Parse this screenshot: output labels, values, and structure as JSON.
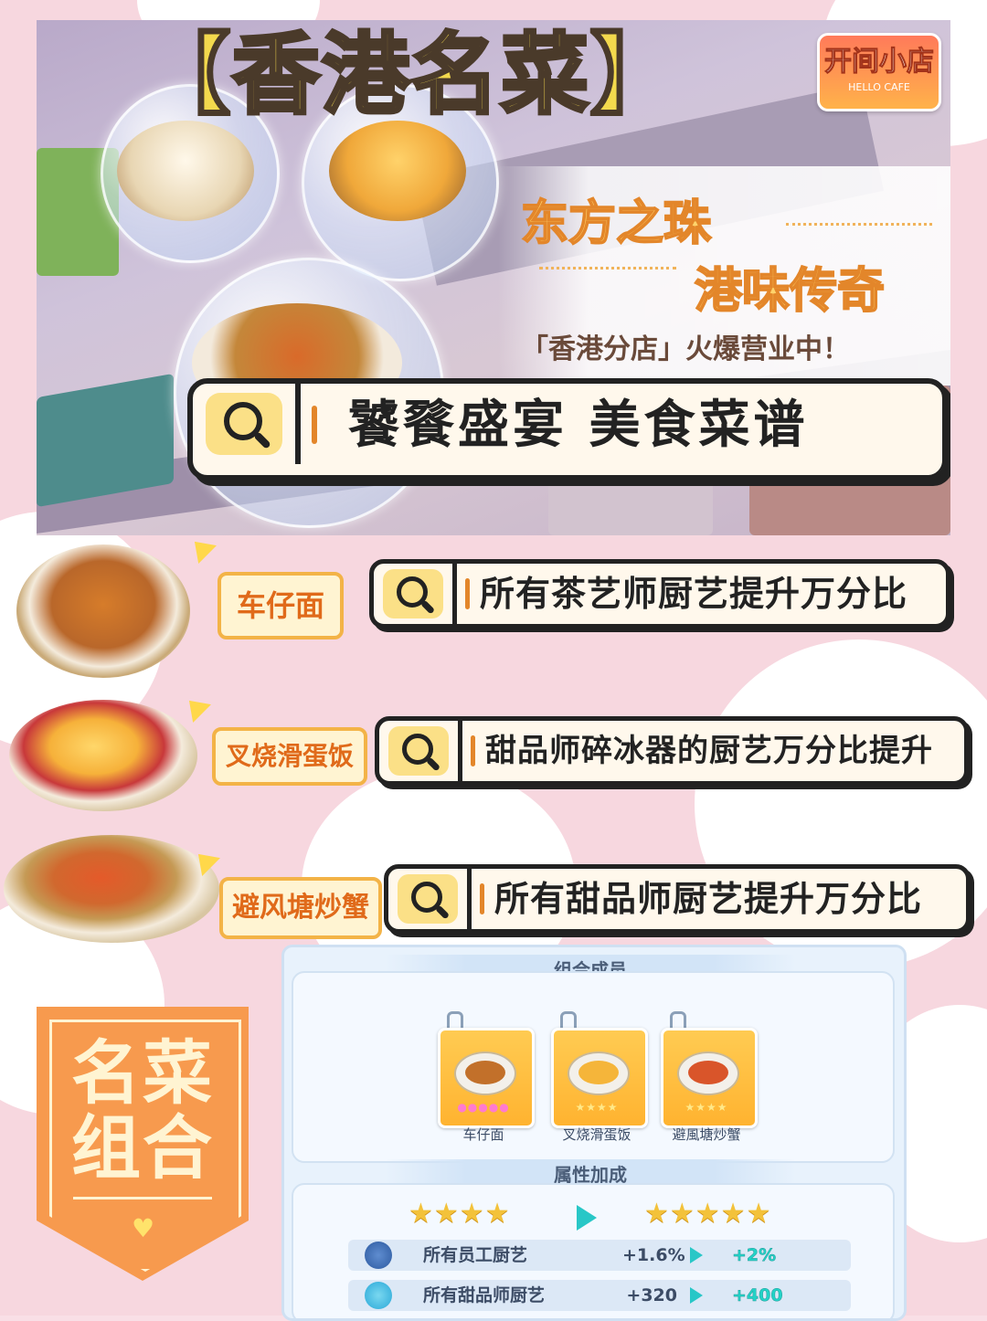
{
  "hero": {
    "title": "【香港名菜】",
    "logo_text": "开间小店",
    "logo_sub": "HELLO CAFE",
    "tagline_1": "东方之珠",
    "tagline_2": "港味传奇",
    "tagline_3": "「香港分店」火爆营业中！",
    "search_text": "饕餮盛宴 美食菜谱"
  },
  "dishes": [
    {
      "name": "车仔面",
      "effect": "所有茶艺师厨艺提升万分比"
    },
    {
      "name": "叉烧滑蛋饭",
      "effect": "甜品师碎冰器的厨艺万分比提升"
    },
    {
      "name": "避风塘炒蟹",
      "effect": "所有甜品师厨艺提升万分比"
    }
  ],
  "combo_badge": {
    "line1": "名菜",
    "line2": "组合"
  },
  "panel": {
    "members_header": "组合成员",
    "members": [
      {
        "name": "车仔面",
        "stars": "●●●●●"
      },
      {
        "name": "叉烧滑蛋饭",
        "stars": "★★★★"
      },
      {
        "name": "避風塘炒蟹",
        "stars": "★★★★"
      }
    ],
    "bonus_header": "属性加成",
    "stars_before": "★★★★",
    "stars_after": "★★★★★",
    "stats": [
      {
        "label": "所有员工厨艺",
        "before": "+1.6%",
        "after": "+2%"
      },
      {
        "label": "所有甜品师厨艺",
        "before": "+320",
        "after": "+400"
      }
    ]
  },
  "colors": {
    "accent_orange": "#f79a4e",
    "search_yellow": "#fbe087",
    "teal": "#28c7c7"
  }
}
